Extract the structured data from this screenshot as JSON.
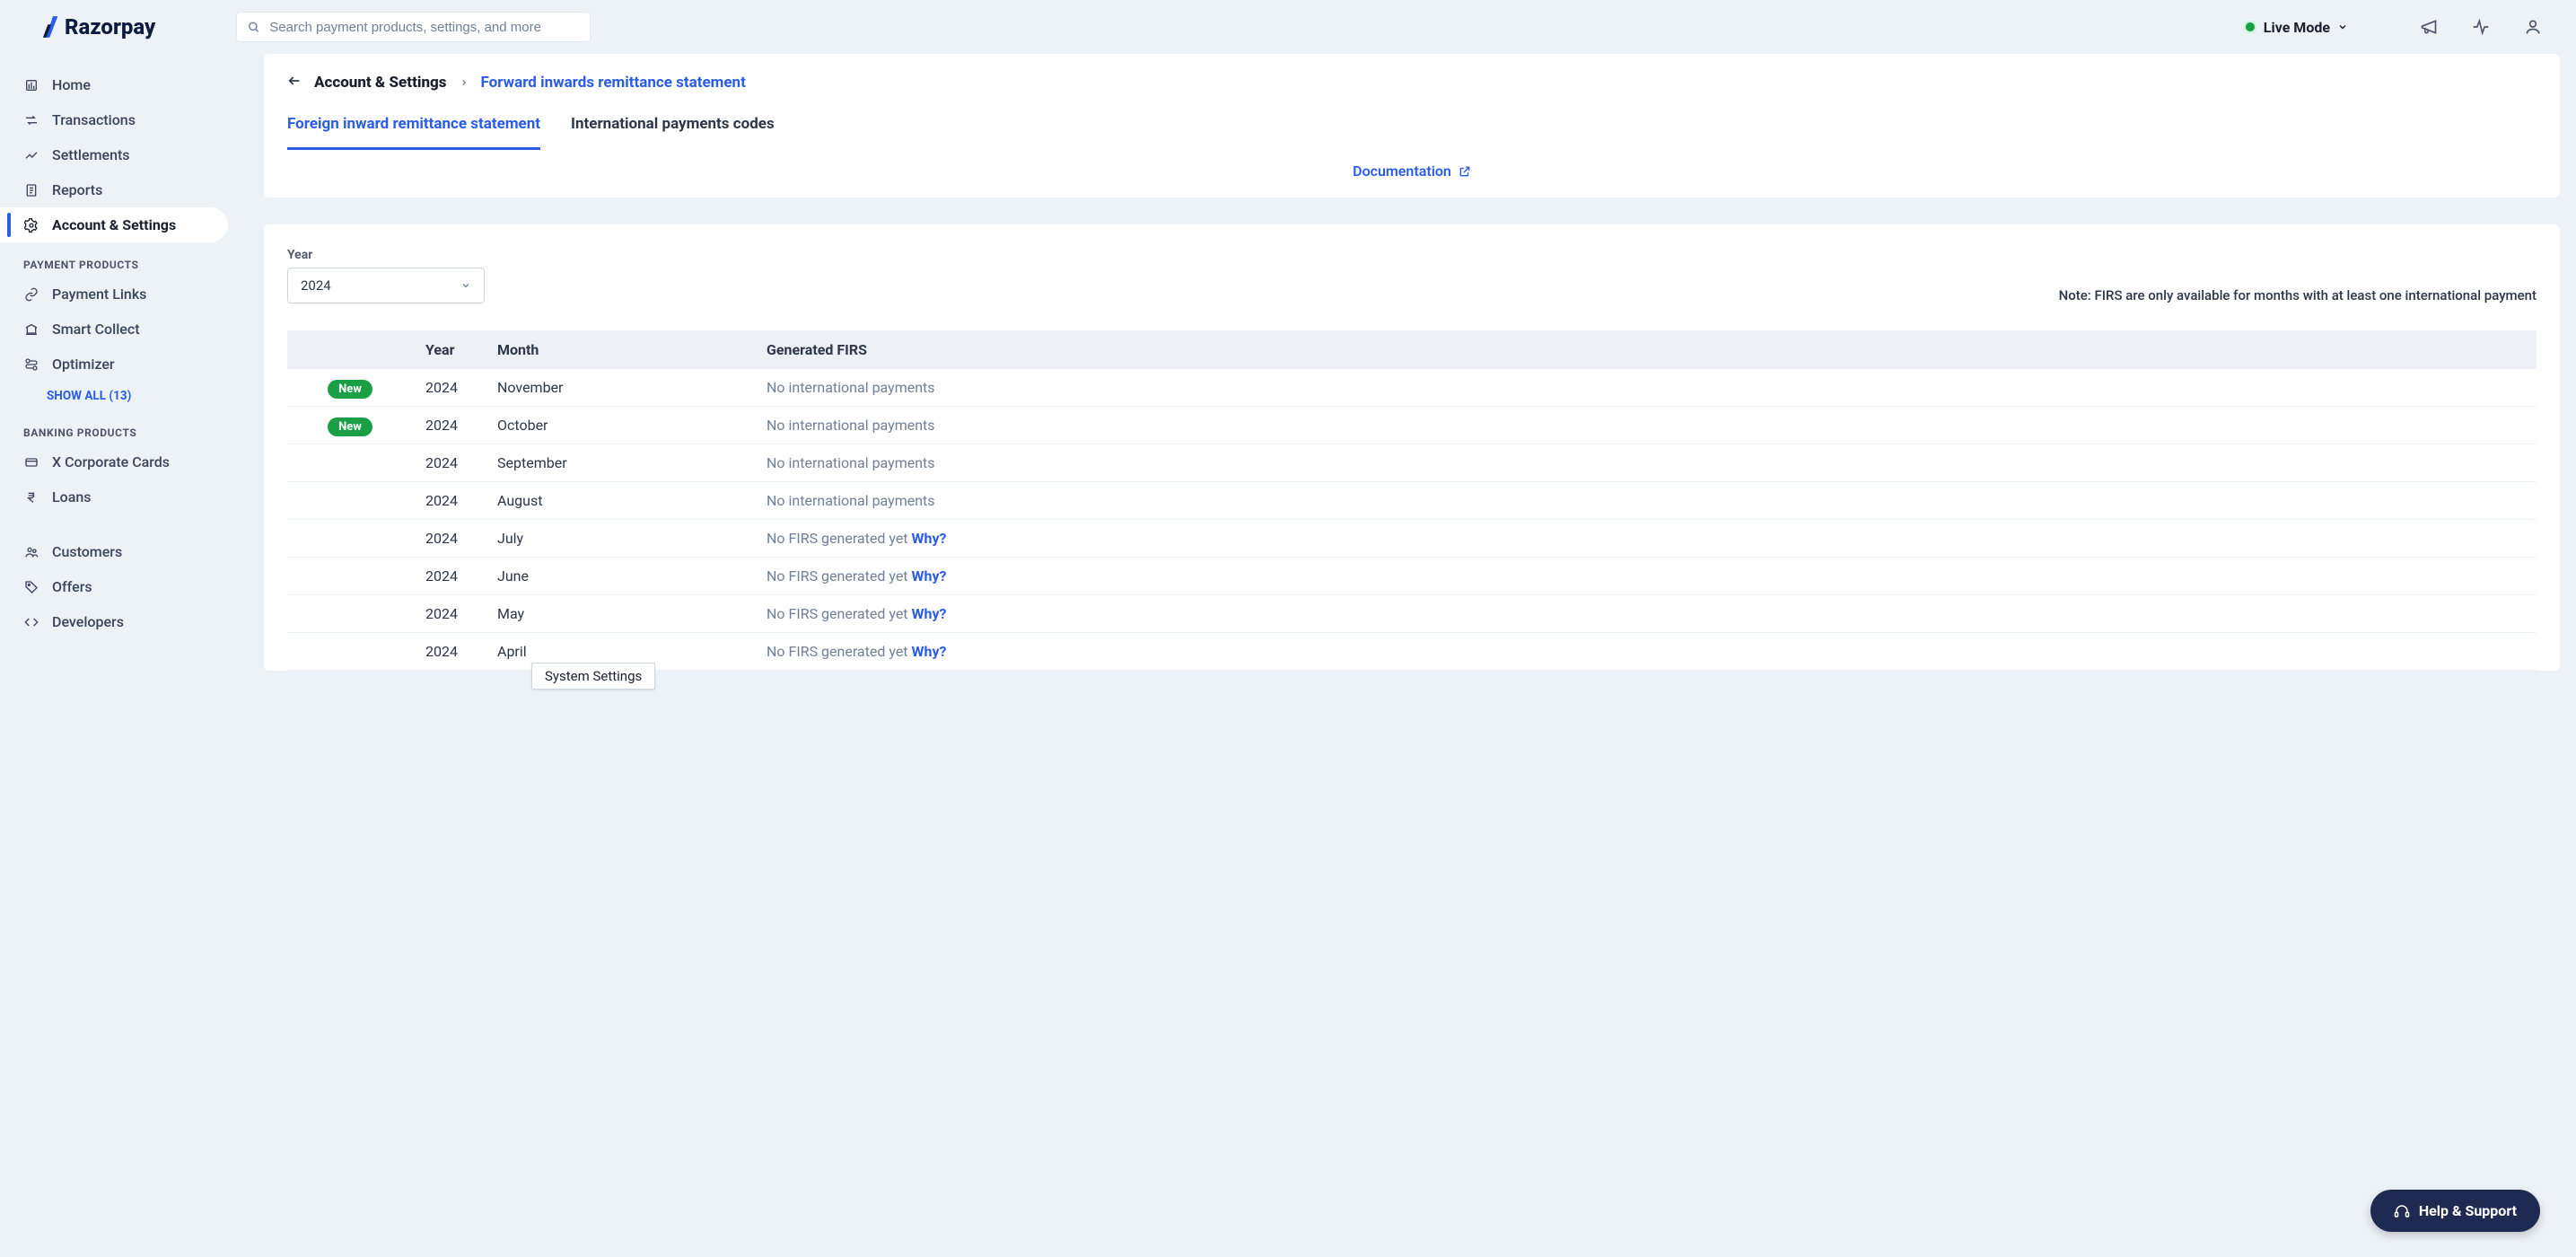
{
  "brand": {
    "name": "Razorpay"
  },
  "topbar": {
    "search_placeholder": "Search payment products, settings, and more",
    "mode_label": "Live Mode"
  },
  "sidebar": {
    "primary": [
      {
        "icon": "home",
        "label": "Home"
      },
      {
        "icon": "transactions",
        "label": "Transactions"
      },
      {
        "icon": "settlements",
        "label": "Settlements"
      },
      {
        "icon": "reports",
        "label": "Reports"
      },
      {
        "icon": "settings",
        "label": "Account & Settings",
        "active": true
      }
    ],
    "sections": [
      {
        "title": "PAYMENT PRODUCTS",
        "items": [
          {
            "icon": "link",
            "label": "Payment Links"
          },
          {
            "icon": "bank",
            "label": "Smart Collect"
          },
          {
            "icon": "optimizer",
            "label": "Optimizer"
          }
        ],
        "show_all": "SHOW ALL (13)"
      },
      {
        "title": "BANKING PRODUCTS",
        "items": [
          {
            "icon": "card",
            "label": "X Corporate Cards"
          },
          {
            "icon": "rupee",
            "label": "Loans"
          }
        ]
      }
    ],
    "bottom": [
      {
        "icon": "customers",
        "label": "Customers"
      },
      {
        "icon": "offers",
        "label": "Offers"
      },
      {
        "icon": "developers",
        "label": "Developers"
      }
    ]
  },
  "breadcrumb": {
    "root": "Account & Settings",
    "current": "Forward inwards remittance statement"
  },
  "tabs": [
    {
      "label": "Foreign inward remittance statement",
      "active": true
    },
    {
      "label": "International payments codes",
      "active": false
    }
  ],
  "documentation_label": "Documentation",
  "filter": {
    "year_label": "Year",
    "year_value": "2024",
    "note": "Note: FIRS are only available for months with at least one international payment"
  },
  "table": {
    "headers": {
      "year": "Year",
      "month": "Month",
      "generated": "Generated FIRS"
    },
    "why_label": "Why?",
    "new_label": "New",
    "rows": [
      {
        "new": true,
        "year": "2024",
        "month": "November",
        "status": "No international payments",
        "why": false
      },
      {
        "new": true,
        "year": "2024",
        "month": "October",
        "status": "No international payments",
        "why": false
      },
      {
        "new": false,
        "year": "2024",
        "month": "September",
        "status": "No international payments",
        "why": false
      },
      {
        "new": false,
        "year": "2024",
        "month": "August",
        "status": "No international payments",
        "why": false
      },
      {
        "new": false,
        "year": "2024",
        "month": "July",
        "status": "No FIRS generated yet ",
        "why": true
      },
      {
        "new": false,
        "year": "2024",
        "month": "June",
        "status": "No FIRS generated yet ",
        "why": true
      },
      {
        "new": false,
        "year": "2024",
        "month": "May",
        "status": "No FIRS generated yet ",
        "why": true
      },
      {
        "new": false,
        "year": "2024",
        "month": "April",
        "status": "No FIRS generated yet ",
        "why": true
      }
    ]
  },
  "tooltip": {
    "label": "System Settings"
  },
  "help": {
    "label": "Help & Support"
  }
}
